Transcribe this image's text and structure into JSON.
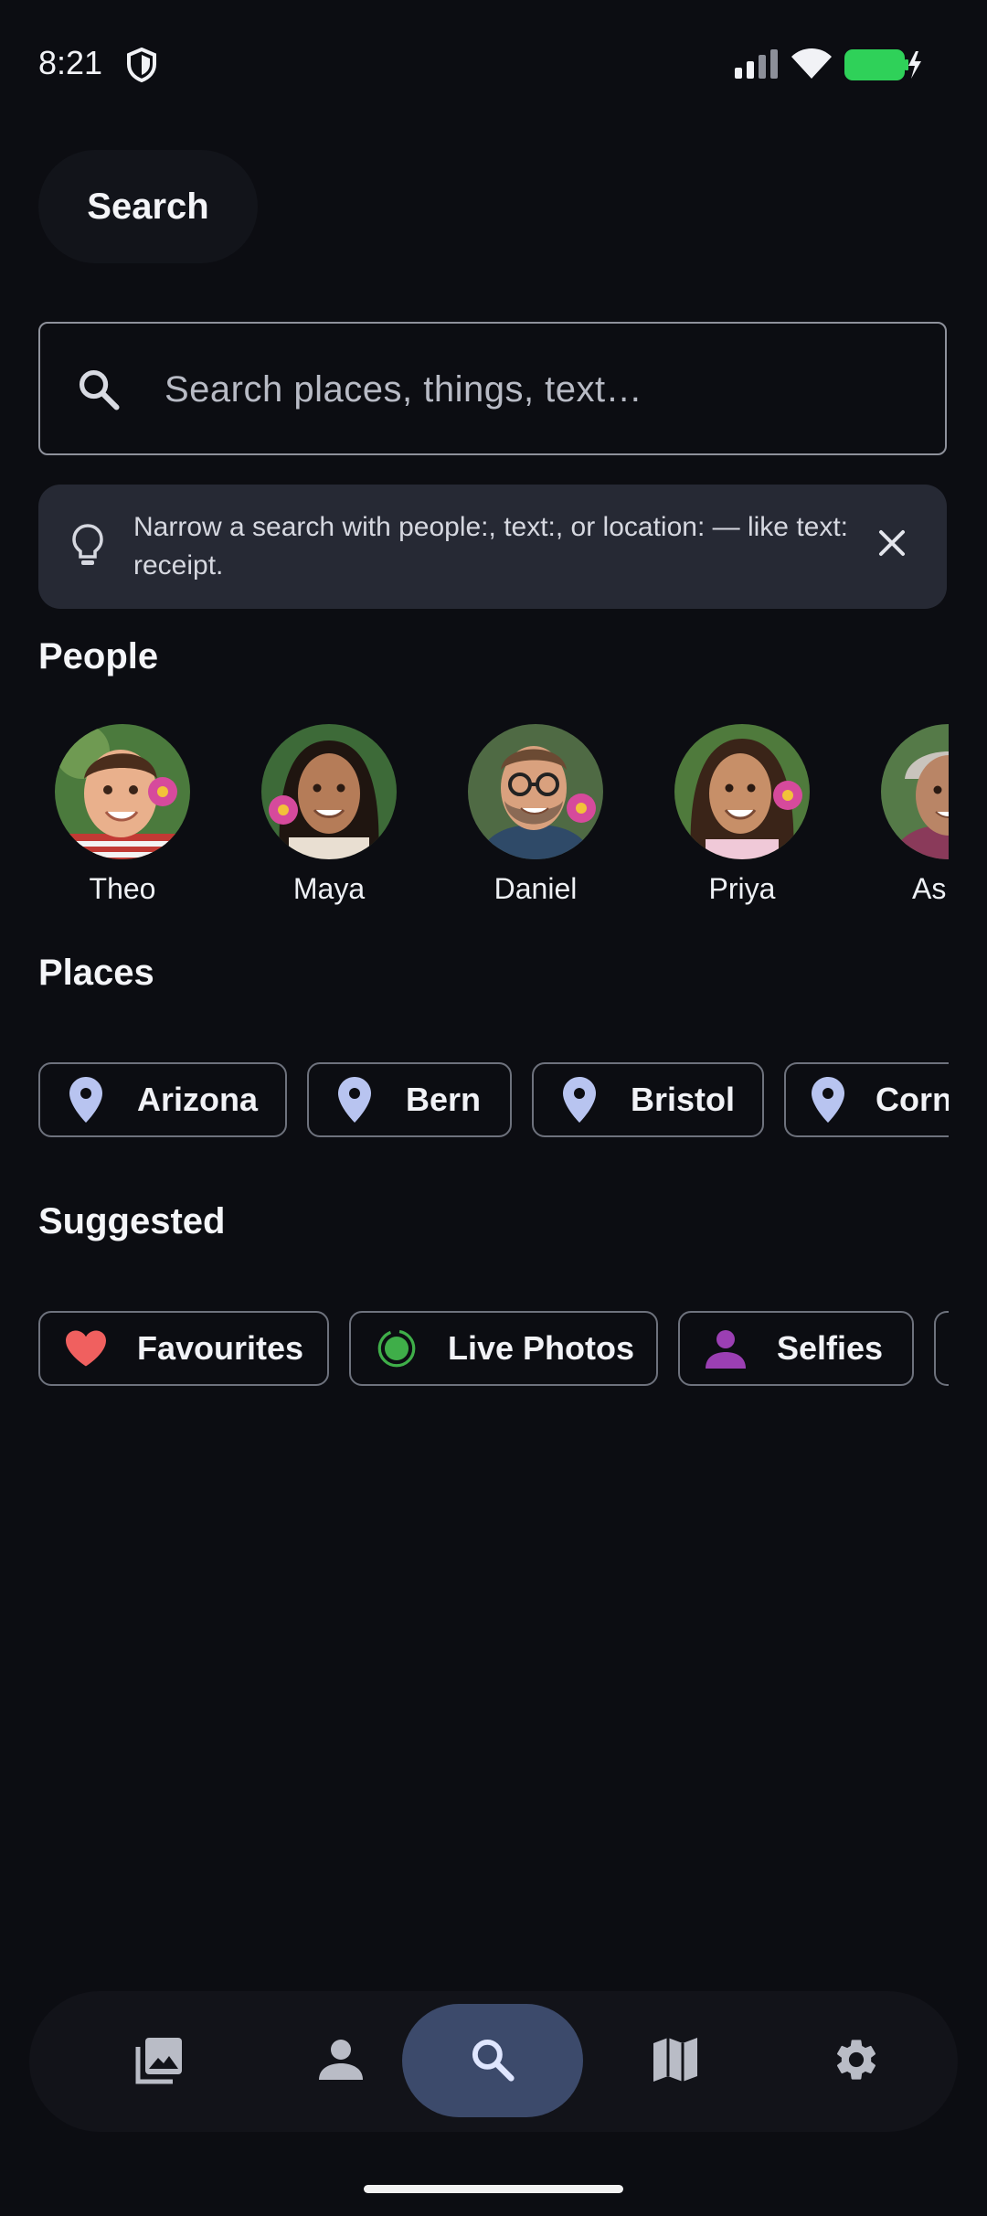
{
  "status_bar": {
    "time": "8:21"
  },
  "header": {
    "title": "Search"
  },
  "search": {
    "placeholder": "Search places, things, text…"
  },
  "tip": {
    "text": "Narrow a search with people:, text:, or location: — like text: receipt."
  },
  "people": {
    "title": "People",
    "items": [
      {
        "name": "Theo"
      },
      {
        "name": "Maya"
      },
      {
        "name": "Daniel"
      },
      {
        "name": "Priya"
      },
      {
        "name": "As"
      }
    ]
  },
  "places": {
    "title": "Places",
    "items": [
      {
        "label": "Arizona",
        "icon": "location-pin-icon"
      },
      {
        "label": "Bern",
        "icon": "location-pin-icon"
      },
      {
        "label": "Bristol",
        "icon": "location-pin-icon"
      },
      {
        "label": "Corn",
        "icon": "location-pin-icon"
      }
    ]
  },
  "suggested": {
    "title": "Suggested",
    "items": [
      {
        "label": "Favourites",
        "icon": "heart-icon",
        "color": "#f0605f"
      },
      {
        "label": "Live Photos",
        "icon": "live-photo-icon",
        "color": "#3fae49"
      },
      {
        "label": "Selfies",
        "icon": "person-icon",
        "color": "#9b3fb3"
      }
    ]
  },
  "nav": {
    "items": [
      {
        "icon": "photos-icon"
      },
      {
        "icon": "people-icon"
      },
      {
        "icon": "search-icon",
        "active": true
      },
      {
        "icon": "map-icon"
      },
      {
        "icon": "settings-icon"
      }
    ]
  },
  "colors": {
    "background": "#0c0d12",
    "accent": "#3c4a6b",
    "pin": "#b8c4f0",
    "battery": "#2fd159"
  }
}
